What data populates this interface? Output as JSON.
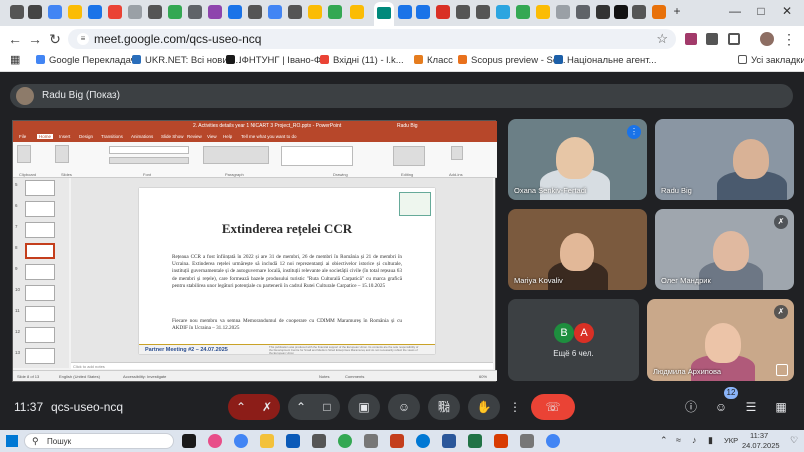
{
  "browser": {
    "url": "meet.google.com/qcs-useo-ncq",
    "new_tab": "+",
    "bookmarks": [
      {
        "label": "Google Перекладач",
        "color": "#4285f4"
      },
      {
        "label": "UKR.NET: Всі новин...",
        "color": "#2a6ebb"
      },
      {
        "label": "ІФНТУНГ | Івано-Ф...",
        "color": "#1a1a1a"
      },
      {
        "label": "Вхідні (11) - l.k...",
        "color": "#ea4335"
      },
      {
        "label": "Класс",
        "color": "#e57c1e"
      },
      {
        "label": "Scopus preview - Sc...",
        "color": "#e9711c"
      },
      {
        "label": "Національне агент...",
        "color": "#1c5fa8"
      }
    ],
    "all_bookmarks": "Усі закладки"
  },
  "meet": {
    "presenter_label": "Radu Big (Показ)",
    "time": "11:37",
    "meeting_code": "qcs-useo-ncq",
    "participants_badge": "12",
    "tiles": [
      {
        "name": "Oxana Senkiv-Fertadi",
        "bg": "#6b7f86"
      },
      {
        "name": "Radu Big",
        "bg": "#8a96a3"
      },
      {
        "name": "Mariya Kovaliv",
        "bg": "#7b5a3e"
      },
      {
        "name": "Олег Мандрик",
        "bg": "#9fa6ae"
      },
      {
        "name": "Ещё 6 чел.",
        "bg": "#3c4043",
        "avatars": [
          {
            "letter": "B",
            "color": "#1e8e3e"
          },
          {
            "letter": "A",
            "color": "#d93025"
          }
        ]
      },
      {
        "name": "Людмила Архипова",
        "bg": "#c9a88a"
      }
    ]
  },
  "presentation": {
    "window_title": "2. Activities details year 1 NICART 3 Project_RO.pptx - PowerPoint",
    "user": "Radu Big",
    "tabs": [
      "File",
      "Home",
      "Insert",
      "Design",
      "Transitions",
      "Animations",
      "Slide Show",
      "Review",
      "View",
      "Help",
      "Tell me what you want to do"
    ],
    "ribbon_groups": [
      "Clipboard",
      "Slides",
      "Font",
      "Paragraph",
      "Drawing",
      "Editing",
      "Add-ins"
    ],
    "slide_numbers": [
      "5",
      "6",
      "7",
      "8",
      "9",
      "10",
      "11",
      "12",
      "13"
    ],
    "slide_title": "Extinderea rețelei CCR",
    "paragraph1": "Rețeaua CCR a fost înființată în 2022 și are 31 de membri, 26 de membri în România și 21 de membri în Ucraina. Extinderea rețelei urmărește să includă 12 noi reprezentanți ai obiectivelor istorice și culturale, instituții guvernamentale și de autoguvernare locală, instituții relevante ale societății civile (în total rețeaua 63 de membri și rețele), care formează bazele produsului turistic \"Ruta Culturală Carpatică\" cu marca grafică pentru stabilirea unor legături potențiale cu partenerii în cadrul Rutei Culturale Carpatice – 15.10.2025",
    "paragraph2": "Fiecare nou membru va semna Memorandumul de cooperare cu CDIMM Maramureș în România și cu AKDIF în Ucraina – 31.12.2025",
    "footer_label": "Partner Meeting #2 – 24.07.2025",
    "footer_disclaimer": "This publication was produced with the financial support of the European Union. Its contents are the sole responsibility of the Development Centre for Small and Medium Sized Enterprises Maramureș and do not necessarily reflect the views of the European Union",
    "notes_placeholder": "Click to add notes",
    "status_left": "Slide 8 of 13",
    "status_lang": "English (United States)",
    "status_access": "Accessibility: Investigate",
    "status_notes": "Notes",
    "status_comments": "Comments",
    "zoom": "60%"
  },
  "taskbar": {
    "search_placeholder": "Пошук",
    "language": "УКР",
    "time": "11:37",
    "date": "24.07.2025"
  },
  "colors": {
    "end_call": "#ea4335",
    "accent": "#8ab4f8",
    "ppt": "#b7472a"
  }
}
